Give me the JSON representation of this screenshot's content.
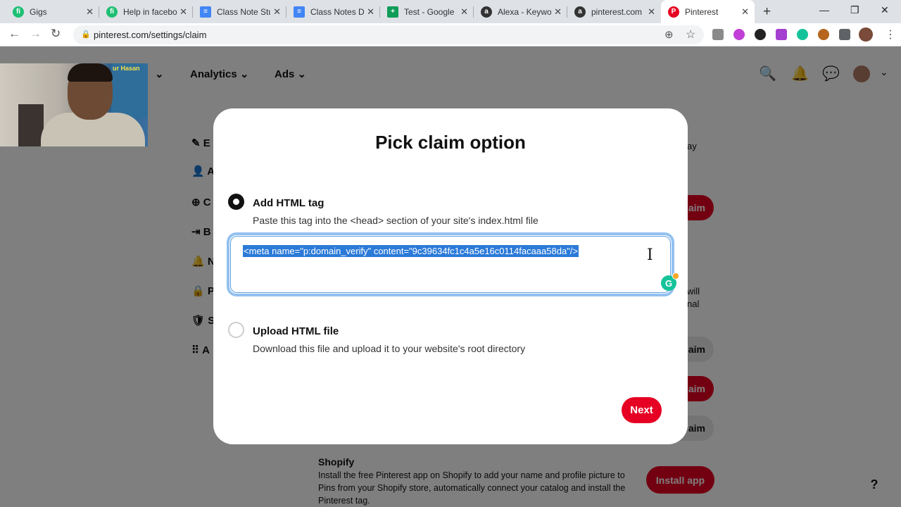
{
  "browser": {
    "tabs": [
      {
        "title": "Gigs",
        "favicon_color": "#1dbf73",
        "favicon_glyph": "fi"
      },
      {
        "title": "Help in facebo",
        "favicon_color": "#1dbf73",
        "favicon_glyph": "fi"
      },
      {
        "title": "Class Note Stu",
        "favicon_color": "#4285f4",
        "favicon_glyph": "≡"
      },
      {
        "title": "Class Notes Di",
        "favicon_color": "#4285f4",
        "favicon_glyph": "≡"
      },
      {
        "title": "Test - Google",
        "favicon_color": "#0f9d58",
        "favicon_glyph": "+"
      },
      {
        "title": "Alexa - Keywo",
        "favicon_color": "#333333",
        "favicon_glyph": "a"
      },
      {
        "title": "pinterest.com",
        "favicon_color": "#333333",
        "favicon_glyph": "a"
      },
      {
        "title": "Pinterest",
        "favicon_color": "#e60023",
        "favicon_glyph": "P"
      }
    ],
    "url": "pinterest.com/settings/claim"
  },
  "pinterest": {
    "nav": {
      "analytics": "Analytics",
      "ads": "Ads"
    },
    "sidebar_letters": [
      "E",
      "A",
      "C",
      "B",
      "N",
      "P",
      "S",
      "A"
    ],
    "right_fragments": {
      "ay": "ay",
      "will": "will",
      "nal": "nal"
    },
    "claim_label": "aim",
    "shopify": {
      "title": "Shopify",
      "description": "Install the free Pinterest app on Shopify to add your name and profile picture to Pins from your Shopify store, automatically connect your catalog and install the Pinterest tag.",
      "install_label": "Install app"
    },
    "help_label": "?"
  },
  "webcam": {
    "poster_text": "ur Hasan"
  },
  "modal": {
    "title": "Pick claim option",
    "option1": {
      "label": "Add HTML tag",
      "description": "Paste this tag into the <head> section of your site's index.html file",
      "selected": true
    },
    "tag_value": "<meta name=\"p:domain_verify\" content=\"9c39634fc1c4a5e16c0114facaaa58da\"/>",
    "option2": {
      "label": "Upload HTML file",
      "description": "Download this file and upload it to your website's root directory",
      "selected": false
    },
    "next_label": "Next"
  }
}
